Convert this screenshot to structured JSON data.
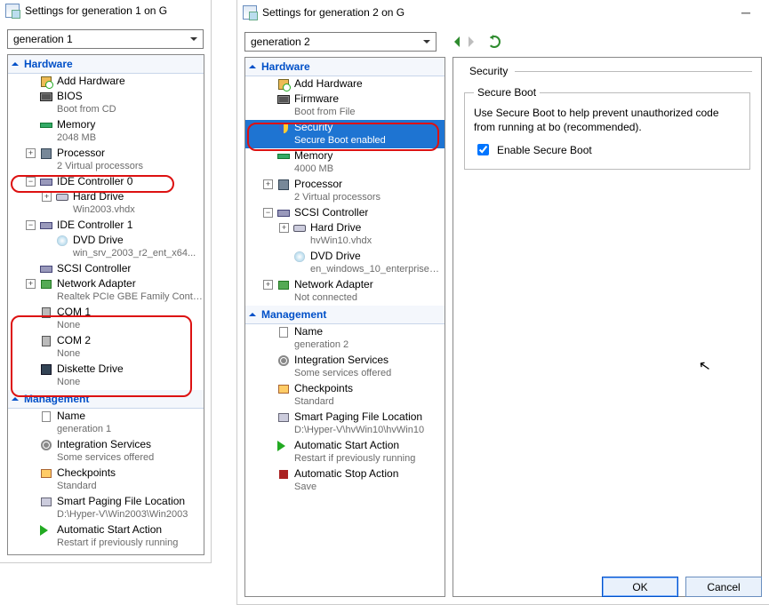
{
  "left": {
    "title": "Settings for generation 1 on G",
    "combo": "generation 1",
    "sections": {
      "hardware": "Hardware",
      "management": "Management"
    },
    "hw": [
      {
        "exp": "",
        "icon": "add",
        "t": "Add Hardware",
        "s": "",
        "name": "add-hardware"
      },
      {
        "exp": "",
        "icon": "chip",
        "t": "BIOS",
        "s": "Boot from CD",
        "name": "bios"
      },
      {
        "exp": "",
        "icon": "mem",
        "t": "Memory",
        "s": "2048 MB",
        "name": "memory"
      },
      {
        "exp": "+",
        "icon": "cpu",
        "t": "Processor",
        "s": "2 Virtual processors",
        "name": "processor"
      },
      {
        "exp": "-",
        "icon": "scsi",
        "t": "IDE Controller 0",
        "s": "",
        "name": "ide-controller-0"
      },
      {
        "exp": "+",
        "icon": "hdd",
        "t": "Hard Drive",
        "s": "Win2003.vhdx",
        "name": "hard-drive",
        "indent": 2
      },
      {
        "exp": "-",
        "icon": "scsi",
        "t": "IDE Controller 1",
        "s": "",
        "name": "ide-controller-1"
      },
      {
        "exp": "",
        "icon": "dvd",
        "t": "DVD Drive",
        "s": "win_srv_2003_r2_ent_x64...",
        "name": "dvd-drive",
        "indent": 2
      },
      {
        "exp": "",
        "icon": "scsi",
        "t": "SCSI Controller",
        "s": "",
        "name": "scsi-controller"
      },
      {
        "exp": "+",
        "icon": "net",
        "t": "Network Adapter",
        "s": "Realtek PCIe GBE Family Contr...",
        "name": "network-adapter"
      },
      {
        "exp": "",
        "icon": "com",
        "t": "COM 1",
        "s": "None",
        "name": "com1"
      },
      {
        "exp": "",
        "icon": "com",
        "t": "COM 2",
        "s": "None",
        "name": "com2"
      },
      {
        "exp": "",
        "icon": "floppy",
        "t": "Diskette Drive",
        "s": "None",
        "name": "diskette-drive"
      }
    ],
    "mg": [
      {
        "icon": "doc",
        "t": "Name",
        "s": "generation 1",
        "name": "mgmt-name"
      },
      {
        "icon": "gear",
        "t": "Integration Services",
        "s": "Some services offered",
        "name": "integration-services"
      },
      {
        "icon": "chk",
        "t": "Checkpoints",
        "s": "Standard",
        "name": "checkpoints"
      },
      {
        "icon": "page",
        "t": "Smart Paging File Location",
        "s": "D:\\Hyper-V\\Win2003\\Win2003",
        "name": "smart-paging"
      },
      {
        "icon": "play",
        "t": "Automatic Start Action",
        "s": "Restart if previously running",
        "name": "auto-start"
      }
    ]
  },
  "right": {
    "title": "Settings for generation 2 on G",
    "combo": "generation 2",
    "sections": {
      "hardware": "Hardware",
      "management": "Management"
    },
    "hw": [
      {
        "exp": "",
        "icon": "add",
        "t": "Add Hardware",
        "s": "",
        "name": "add-hardware"
      },
      {
        "exp": "",
        "icon": "chip",
        "t": "Firmware",
        "s": "Boot from File",
        "name": "firmware"
      },
      {
        "exp": "",
        "icon": "shield",
        "t": "Security",
        "s": "Secure Boot enabled",
        "name": "security",
        "selected": true
      },
      {
        "exp": "",
        "icon": "mem",
        "t": "Memory",
        "s": "4000 MB",
        "name": "memory"
      },
      {
        "exp": "+",
        "icon": "cpu",
        "t": "Processor",
        "s": "2 Virtual processors",
        "name": "processor"
      },
      {
        "exp": "-",
        "icon": "scsi",
        "t": "SCSI Controller",
        "s": "",
        "name": "scsi-controller"
      },
      {
        "exp": "+",
        "icon": "hdd",
        "t": "Hard Drive",
        "s": "hvWin10.vhdx",
        "name": "hard-drive",
        "indent": 2
      },
      {
        "exp": "",
        "icon": "dvd",
        "t": "DVD Drive",
        "s": "en_windows_10_enterprise_v...",
        "name": "dvd-drive",
        "indent": 2
      },
      {
        "exp": "+",
        "icon": "net",
        "t": "Network Adapter",
        "s": "Not connected",
        "name": "network-adapter"
      }
    ],
    "mg": [
      {
        "icon": "doc",
        "t": "Name",
        "s": "generation 2",
        "name": "mgmt-name"
      },
      {
        "icon": "gear",
        "t": "Integration Services",
        "s": "Some services offered",
        "name": "integration-services"
      },
      {
        "icon": "chk",
        "t": "Checkpoints",
        "s": "Standard",
        "name": "checkpoints"
      },
      {
        "icon": "page",
        "t": "Smart Paging File Location",
        "s": "D:\\Hyper-V\\hvWin10\\hvWin10",
        "name": "smart-paging"
      },
      {
        "icon": "play",
        "t": "Automatic Start Action",
        "s": "Restart if previously running",
        "name": "auto-start"
      },
      {
        "icon": "stop",
        "t": "Automatic Stop Action",
        "s": "Save",
        "name": "auto-stop"
      }
    ],
    "detail": {
      "heading": "Security",
      "group": "Secure Boot",
      "desc": "Use Secure Boot to help prevent unauthorized code from running at bo (recommended).",
      "checkbox": "Enable Secure Boot"
    },
    "buttons": {
      "ok": "OK",
      "cancel": "Cancel"
    }
  }
}
